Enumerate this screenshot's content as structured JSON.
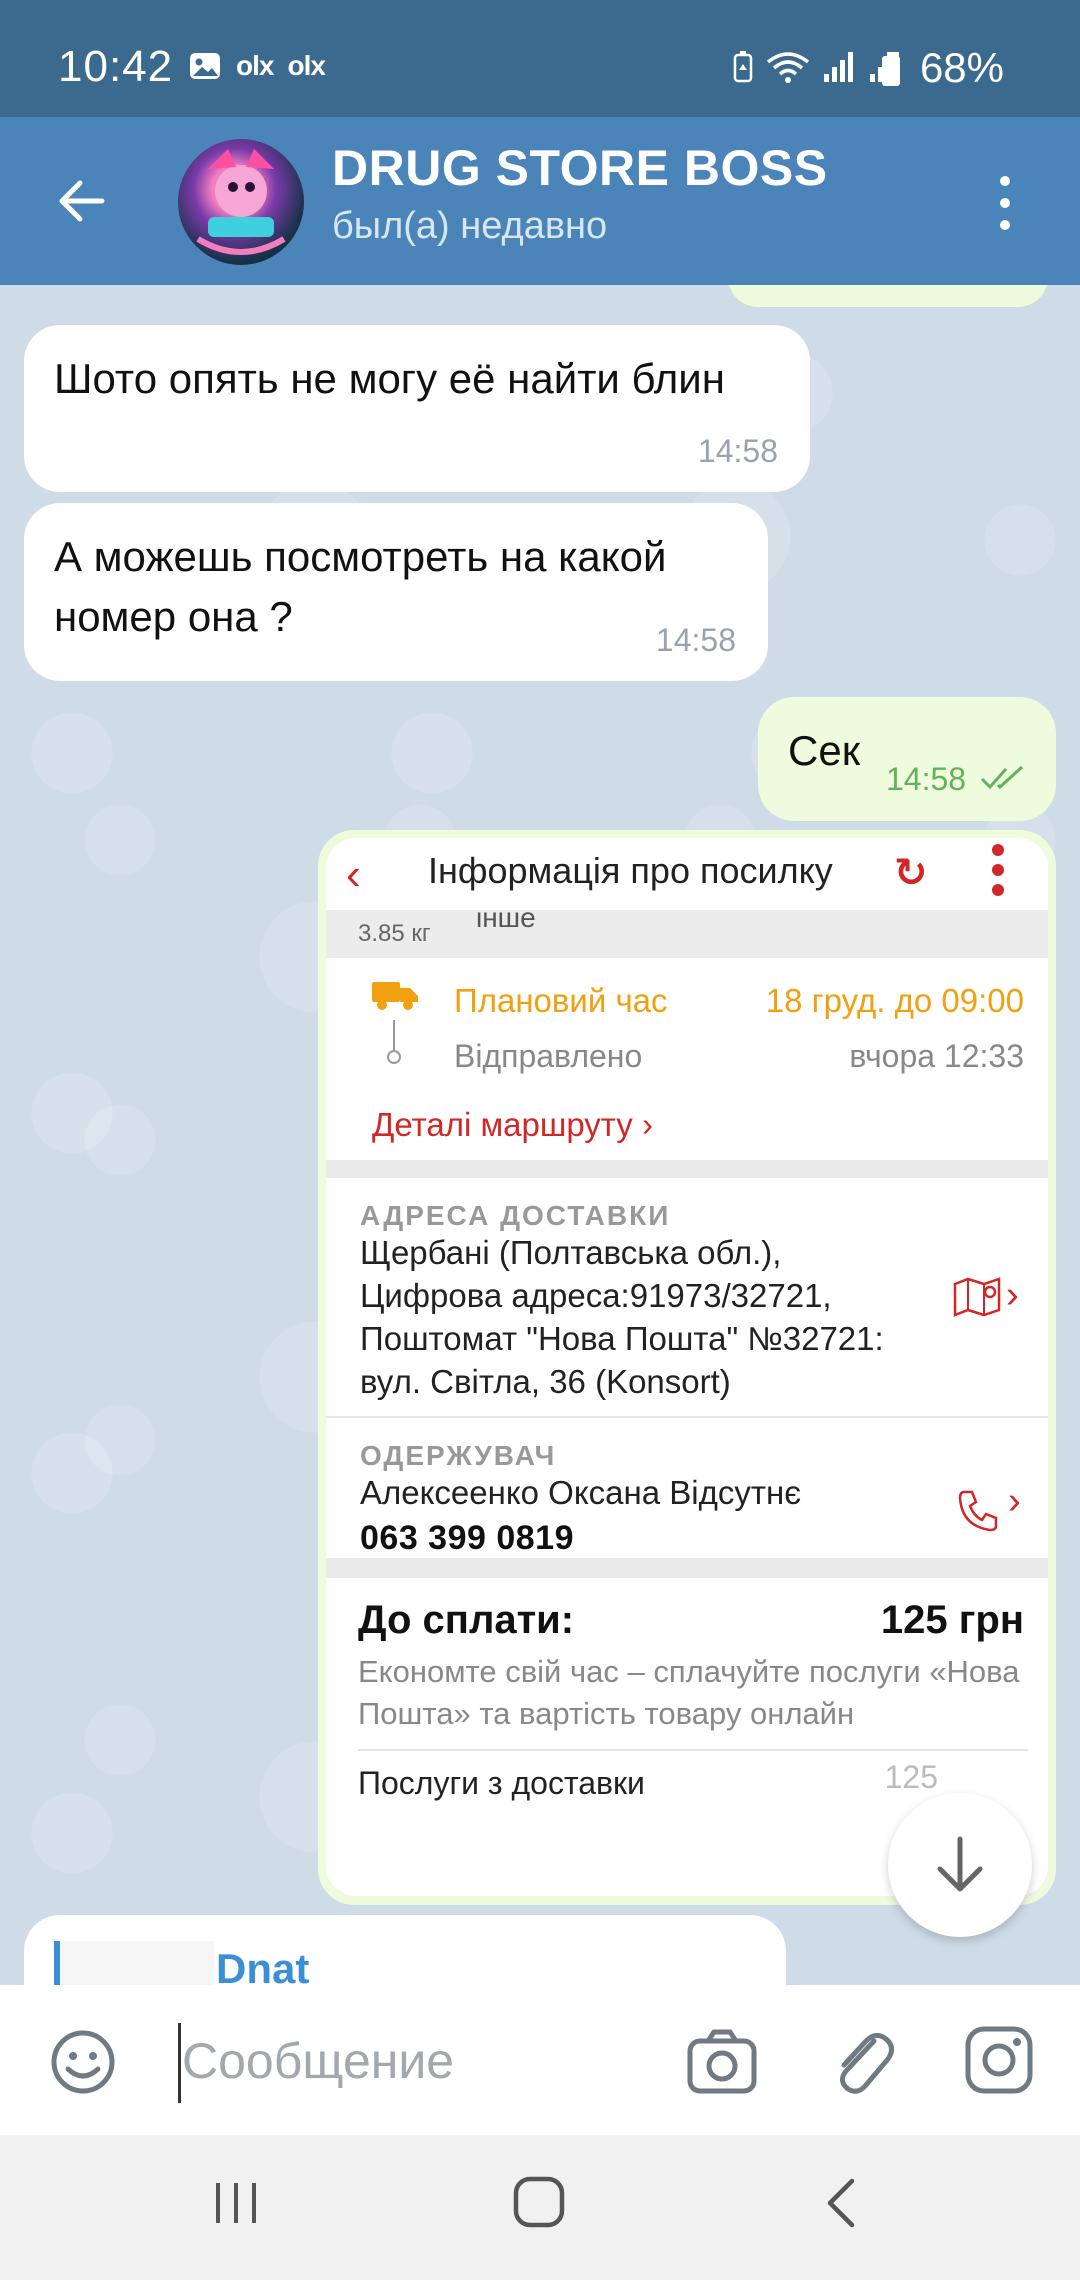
{
  "status_bar": {
    "time": "10:42",
    "left_icons": [
      "image-icon",
      "olx-icon",
      "olx-icon"
    ],
    "olx_label": "olx",
    "right_icons": [
      "battery-saver-icon",
      "wifi-icon",
      "signal-icon",
      "signal-icon"
    ],
    "battery": "68%"
  },
  "header": {
    "title": "DRUG STORE BOSS",
    "subtitle": "был(а) недавно"
  },
  "messages": [
    {
      "direction": "in",
      "text": "Шото опять не могу её найти блин",
      "time": "14:58"
    },
    {
      "direction": "in",
      "text": "А можешь посмотреть на какой номер она ?",
      "time": "14:58"
    },
    {
      "direction": "out",
      "text": "Сек",
      "time": "14:58",
      "status": "read"
    }
  ],
  "screenshot": {
    "title": "Інформація про посилку",
    "weight": "3.85 кг",
    "type_partial": "інше",
    "planned_label": "Плановий час",
    "planned_value": "18 груд. до 09:00",
    "sent_label": "Відправлено",
    "sent_value": "вчора 12:33",
    "route_details": "Деталі маршруту",
    "address_label": "АДРЕСА ДОСТАВКИ",
    "address_text": "Щербані (Полтавська обл.), Цифрова адреса:91973/32721, Поштомат \"Нова Пошта\" №32721: вул. Світла, 36 (Konsort)",
    "recipient_label": "ОДЕРЖУВАЧ",
    "recipient_name": "Алексеенко Оксана Відсутнє",
    "recipient_phone": "063 399 0819",
    "pay_label": "До сплати:",
    "pay_value": "125 грн",
    "pay_note": "Економте свій час – сплачуйте послуги «Нова Пошта» та вартість товару онлайн",
    "services_label": "Послуги з доставки",
    "services_value_partial": "125"
  },
  "next_message": {
    "title": "Dnat"
  },
  "input": {
    "placeholder": "Сообщение"
  },
  "colors": {
    "status_bar": "#3c6a8e",
    "header": "#4a84b8",
    "outgoing_bubble": "#eefbdc",
    "accent_red": "#d32727",
    "accent_orange": "#f0a010",
    "read_ticks": "#63b15c"
  }
}
